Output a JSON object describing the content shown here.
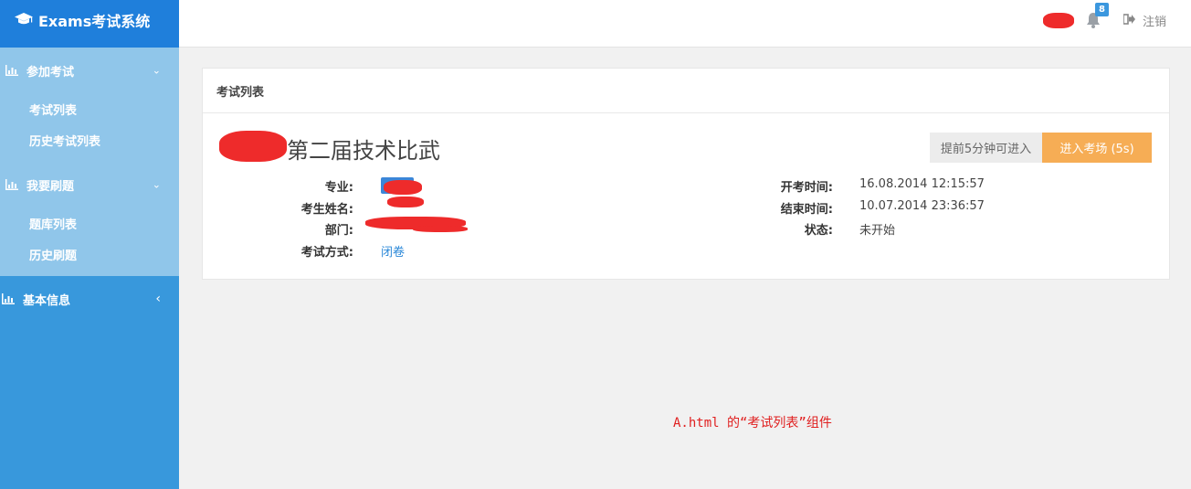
{
  "brand": {
    "title": "Exams考试系统",
    "icon": "graduation-cap-icon"
  },
  "topbar": {
    "notification_count": "8",
    "logout_label": "注销"
  },
  "sidebar": {
    "groups": [
      {
        "label": "参加考试",
        "icon": "bar-chart-icon",
        "chevron": "⌄",
        "expanded": true,
        "items": [
          {
            "label": "考试列表"
          },
          {
            "label": "历史考试列表"
          }
        ]
      },
      {
        "label": "我要刷题",
        "icon": "bar-chart-icon",
        "chevron": "⌄",
        "expanded": true,
        "items": [
          {
            "label": "题库列表"
          },
          {
            "label": "历史刷题"
          }
        ]
      },
      {
        "label": "基本信息",
        "icon": "bar-chart-icon",
        "chevron": "‹",
        "expanded": false,
        "items": []
      }
    ]
  },
  "panel": {
    "title": "考试列表",
    "exam": {
      "title": "第二届技术比武",
      "early_entry_label": "提前5分钟可进入",
      "enter_label": "进入考场 (5s)",
      "fields_left": [
        {
          "label": "专业:",
          "value": ""
        },
        {
          "label": "考生姓名:",
          "value": ""
        },
        {
          "label": "部门:",
          "value": ""
        },
        {
          "label": "考试方式:",
          "value": "闭卷"
        }
      ],
      "fields_right": [
        {
          "label": "开考时间:",
          "value": "16.08.2014 12:15:57"
        },
        {
          "label": "结束时间:",
          "value": "10.07.2014 23:36:57"
        },
        {
          "label": "状态:",
          "value": "未开始"
        }
      ]
    }
  },
  "note": "A.html 的“考试列表”组件",
  "colors": {
    "accent": "#3898dc",
    "brand": "#1f7fdb",
    "enter_button": "#f6ad55",
    "note": "#e02020"
  }
}
